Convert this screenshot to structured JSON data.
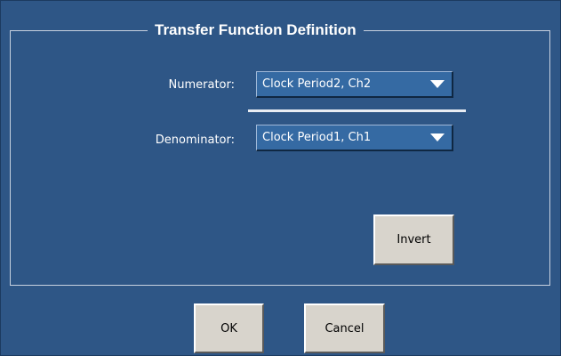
{
  "dialog": {
    "group_title": "Transfer Function Definition",
    "numerator": {
      "label": "Numerator:",
      "value": "Clock Period2, Ch2"
    },
    "denominator": {
      "label": "Denominator:",
      "value": "Clock Period1, Ch1"
    },
    "invert_label": "Invert",
    "ok_label": "OK",
    "cancel_label": "Cancel",
    "icons": {
      "dropdown": "chevron-down-icon"
    },
    "colors": {
      "background": "#2e5686",
      "combo": "#356aa3",
      "button": "#d8d4cc"
    }
  }
}
